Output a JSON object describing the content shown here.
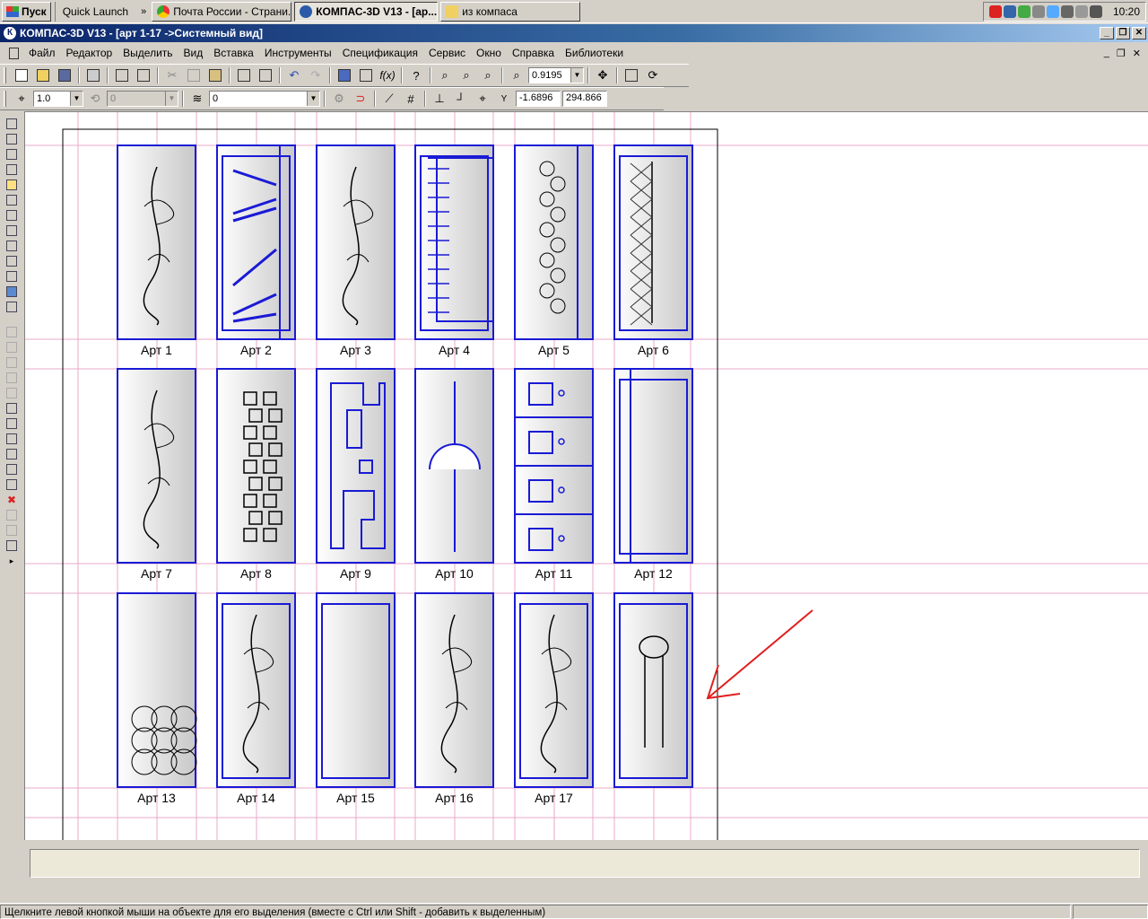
{
  "taskbar": {
    "start_label": "Пуск",
    "quick_launch": "Quick Launch",
    "chevron": "»",
    "tasks": [
      {
        "label": "Почта России - Страни..."
      },
      {
        "label": "КОМПАС-3D V13 - [ар..."
      },
      {
        "label": "из компаса"
      }
    ],
    "clock": "10:20"
  },
  "window": {
    "title": "КОМПАС-3D V13 - [арт 1-17 ->Системный вид]"
  },
  "menu": {
    "items": [
      "Файл",
      "Редактор",
      "Выделить",
      "Вид",
      "Вставка",
      "Инструменты",
      "Спецификация",
      "Сервис",
      "Окно",
      "Справка",
      "Библиотеки"
    ]
  },
  "toolbar": {
    "zoom_value": "0.9195",
    "step_value": "1.0",
    "angle_value": "0",
    "layer_value": "0",
    "coord_x": "-1.6896",
    "coord_y": "294.866"
  },
  "drawing": {
    "labels": [
      "Арт 1",
      "Арт 2",
      "Арт 3",
      "Арт 4",
      "Арт 5",
      "Арт 6",
      "Арт 7",
      "Арт 8",
      "Арт 9",
      "Арт 10",
      "Арт 11",
      "Арт 12",
      "Арт 13",
      "Арт 14",
      "Арт 15",
      "Арт 16",
      "Арт 17",
      ""
    ],
    "panel_stroke": "#1a1ad6",
    "guide_color": "#e8a8c8",
    "arrow_color": "#e02020"
  },
  "status": {
    "text": "Щелкните левой кнопкой мыши на объекте для его выделения (вместе с Ctrl или Shift - добавить к выделенным)"
  }
}
